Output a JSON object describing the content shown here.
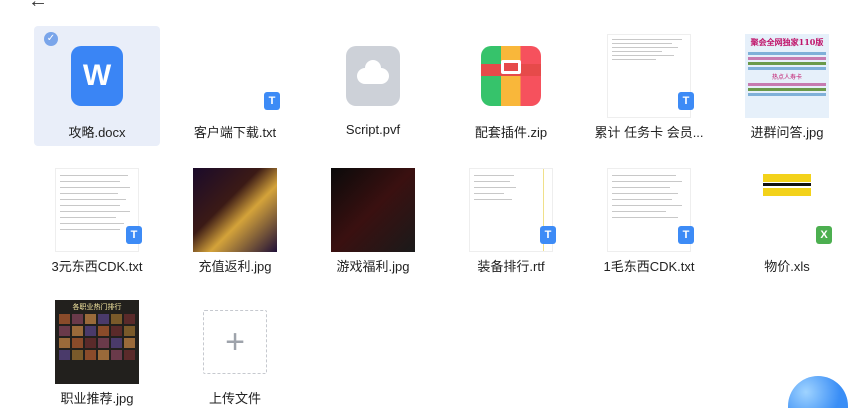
{
  "header": {
    "back_icon": "arrow-left-icon"
  },
  "files": [
    {
      "name": "攻略.docx",
      "type": "docx",
      "selected": true
    },
    {
      "name": "客户端下载.txt",
      "type": "txt"
    },
    {
      "name": "Script.pvf",
      "type": "pvf"
    },
    {
      "name": "配套插件.zip",
      "type": "zip"
    },
    {
      "name": "累计 任务卡 会员...",
      "type": "txt"
    },
    {
      "name": "进群问答.jpg",
      "type": "jpg"
    },
    {
      "name": "3元东西CDK.txt",
      "type": "txt"
    },
    {
      "name": "充值返利.jpg",
      "type": "jpg"
    },
    {
      "name": "游戏福利.jpg",
      "type": "jpg"
    },
    {
      "name": "装备排行.rtf",
      "type": "rtf"
    },
    {
      "name": "1毛东西CDK.txt",
      "type": "txt"
    },
    {
      "name": "物价.xls",
      "type": "xls"
    },
    {
      "name": "职业推荐.jpg",
      "type": "jpg"
    }
  ],
  "upload": {
    "label": "上传文件",
    "icon": "plus-icon"
  },
  "thumb_texts": {
    "jinqun_title": "聚会全网独家110版",
    "jinqun_sub": "热点人寿卡",
    "zhiye_title": "各职业热门排行"
  },
  "colors": {
    "selection_bg": "#e9eef9",
    "doc_blue": "#3a85f5",
    "txt_badge": "#3d8bf6",
    "xls_badge": "#4caf50"
  }
}
